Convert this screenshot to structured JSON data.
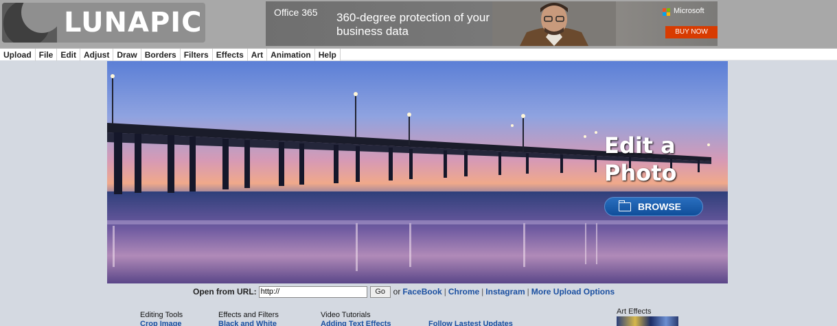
{
  "header": {
    "logo_text": "LUNAPIC"
  },
  "ad": {
    "brand": "Office 365",
    "headline": "360-degree protection of your business data",
    "advertiser": "Microsoft",
    "cta": "BUY NOW",
    "ms_colors": [
      "#f25022",
      "#7fba00",
      "#00a4ef",
      "#ffb900"
    ]
  },
  "menu": {
    "items": [
      "Upload",
      "File",
      "Edit",
      "Adjust",
      "Draw",
      "Borders",
      "Filters",
      "Effects",
      "Art",
      "Animation",
      "Help"
    ]
  },
  "hero": {
    "title_line1": "Edit a",
    "title_line2": "Photo",
    "browse_label": "BROWSE"
  },
  "url_row": {
    "label": "Open from URL:",
    "input_value": "http://",
    "go_label": "Go",
    "or_text": "or",
    "links": [
      "FaceBook",
      "Chrome",
      "Instagram",
      "More Upload Options"
    ]
  },
  "footer": {
    "editing_tools": {
      "heading": "Editing Tools",
      "first_link": "Crop Image"
    },
    "effects_filters": {
      "heading": "Effects and Filters",
      "first_link": "Black and White"
    },
    "video_tutorials": {
      "heading": "Video Tutorials",
      "first_link": "Adding Text Effects"
    },
    "follow": {
      "link": "Follow Lastest Updates"
    },
    "art_effects": {
      "heading": "Art Effects"
    }
  },
  "colors": {
    "link": "#1a4fa0",
    "page_bg": "#d4d9e1",
    "header_bg": "#a8a8a8",
    "browse_btn": "#1a5aa8"
  }
}
